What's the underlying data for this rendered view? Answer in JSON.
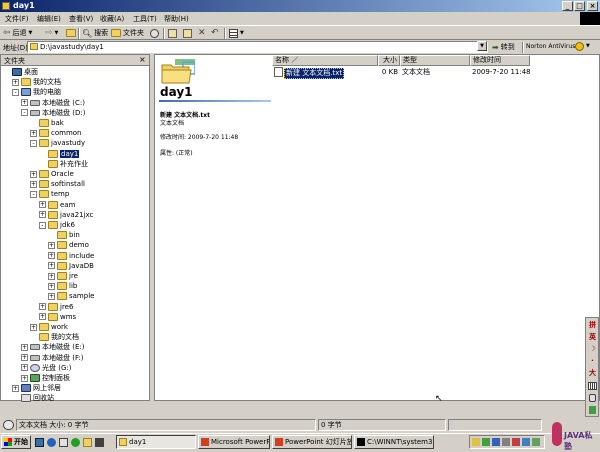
{
  "window": {
    "title": "day1"
  },
  "menu": [
    "文件(F)",
    "编辑(E)",
    "查看(V)",
    "收藏(A)",
    "工具(T)",
    "帮助(H)"
  ],
  "toolbar": {
    "back_label": "后退",
    "search_label": "搜索",
    "folders_label": "文件夹"
  },
  "address": {
    "label": "地址(D)",
    "value": "D:\\javastudy\\day1",
    "go_label": "转到",
    "norton_label": "Norton AntiVirus"
  },
  "folderpane": {
    "title": "文件夹"
  },
  "tree": [
    {
      "label": "桌面",
      "level": 0,
      "icon": "desk",
      "exp": ""
    },
    {
      "label": "我的文档",
      "level": 1,
      "icon": "folder",
      "exp": "+"
    },
    {
      "label": "我的电脑",
      "level": 1,
      "icon": "pc",
      "exp": "-"
    },
    {
      "label": "本地磁盘 (C:)",
      "level": 2,
      "icon": "drive",
      "exp": "+"
    },
    {
      "label": "本地磁盘 (D:)",
      "level": 2,
      "icon": "drive",
      "exp": "-"
    },
    {
      "label": "bak",
      "level": 3,
      "icon": "folder",
      "exp": ""
    },
    {
      "label": "common",
      "level": 3,
      "icon": "folder",
      "exp": "+"
    },
    {
      "label": "javastudy",
      "level": 3,
      "icon": "folder",
      "exp": "-"
    },
    {
      "label": "day1",
      "level": 4,
      "icon": "folder",
      "exp": "",
      "selected": true
    },
    {
      "label": "补充作业",
      "level": 4,
      "icon": "folder",
      "exp": ""
    },
    {
      "label": "Oracle",
      "level": 3,
      "icon": "folder",
      "exp": "+"
    },
    {
      "label": "softinstall",
      "level": 3,
      "icon": "folder",
      "exp": "+"
    },
    {
      "label": "temp",
      "level": 3,
      "icon": "folder",
      "exp": "-"
    },
    {
      "label": "eam",
      "level": 4,
      "icon": "folder",
      "exp": "+"
    },
    {
      "label": "java21jxc",
      "level": 4,
      "icon": "folder",
      "exp": "+"
    },
    {
      "label": "jdk6",
      "level": 4,
      "icon": "folder",
      "exp": "-"
    },
    {
      "label": "bin",
      "level": 5,
      "icon": "folder",
      "exp": ""
    },
    {
      "label": "demo",
      "level": 5,
      "icon": "folder",
      "exp": "+"
    },
    {
      "label": "include",
      "level": 5,
      "icon": "folder",
      "exp": "+"
    },
    {
      "label": "JavaDB",
      "level": 5,
      "icon": "folder",
      "exp": "+"
    },
    {
      "label": "jre",
      "level": 5,
      "icon": "folder",
      "exp": "+"
    },
    {
      "label": "lib",
      "level": 5,
      "icon": "folder",
      "exp": "+"
    },
    {
      "label": "sample",
      "level": 5,
      "icon": "folder",
      "exp": "+"
    },
    {
      "label": "jre6",
      "level": 4,
      "icon": "folder",
      "exp": "+"
    },
    {
      "label": "wms",
      "level": 4,
      "icon": "folder",
      "exp": "+"
    },
    {
      "label": "work",
      "level": 3,
      "icon": "folder",
      "exp": "+"
    },
    {
      "label": "我的文档",
      "level": 3,
      "icon": "folder",
      "exp": ""
    },
    {
      "label": "本地磁盘 (E:)",
      "level": 2,
      "icon": "drive",
      "exp": "+"
    },
    {
      "label": "本地磁盘 (F:)",
      "level": 2,
      "icon": "drive",
      "exp": "+"
    },
    {
      "label": "光盘 (G:)",
      "level": 2,
      "icon": "cd",
      "exp": "+"
    },
    {
      "label": "控制面板",
      "level": 2,
      "icon": "cp",
      "exp": "+"
    },
    {
      "label": "网上邻居",
      "level": 1,
      "icon": "net",
      "exp": "+"
    },
    {
      "label": "回收站",
      "level": 1,
      "icon": "bin",
      "exp": ""
    }
  ],
  "webview": {
    "folder_title": "day1",
    "file_name": "新建 文本文档.txt",
    "file_type": "文本文档",
    "modified": "修改时间: 2009-7-20 11:48",
    "attributes": "属性: (正常)"
  },
  "list": {
    "columns": [
      "名称 ／",
      "大小",
      "类型",
      "修改时间"
    ],
    "rows": [
      {
        "name": "新建 文本文档.txt",
        "size": "0 KB",
        "type": "文本文档",
        "modified": "2009-7-20 11:48"
      }
    ]
  },
  "status": {
    "left": "文本文档 大小: 0 字节",
    "mid": "0 字节"
  },
  "taskbar": {
    "start_label": "开始",
    "tasks": [
      "day1",
      "Microsoft PowerPoi...",
      "PowerPoint 幻灯片放...",
      "C:\\WINNT\\system3..."
    ],
    "watermark": "JAVA私塾"
  },
  "ime": [
    "拼",
    "英",
    "☽",
    "·",
    "大"
  ]
}
